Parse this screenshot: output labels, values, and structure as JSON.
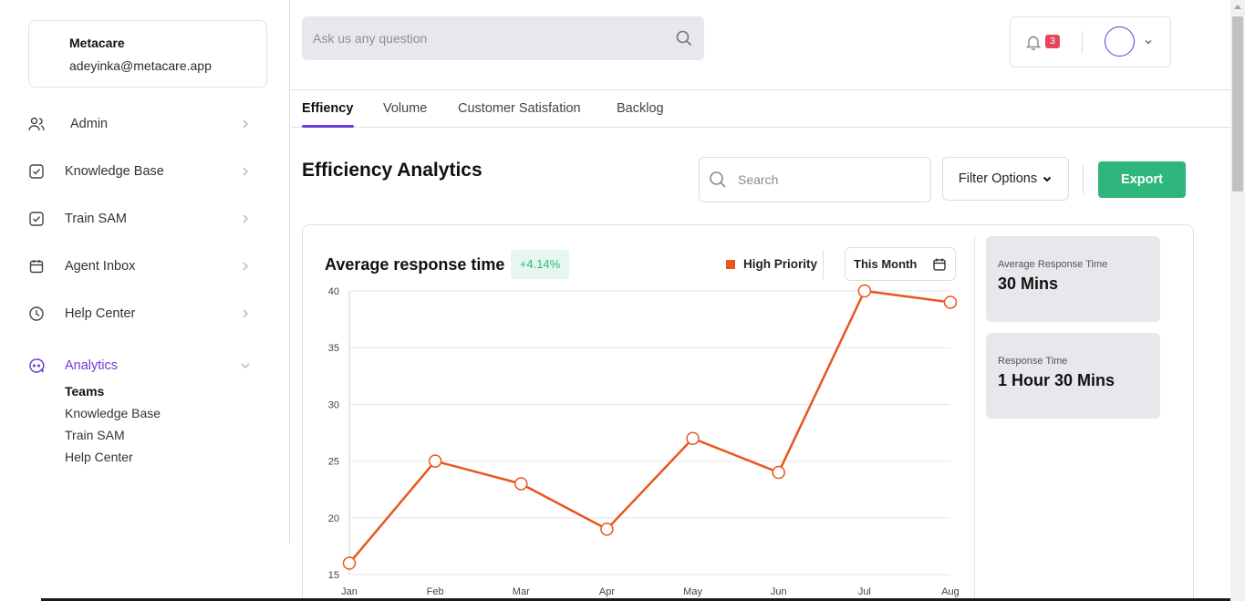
{
  "account": {
    "name": "Metacare",
    "email": "adeyinka@metacare.app"
  },
  "sidebar": {
    "items": [
      {
        "label": "Admin",
        "icon": "users-icon"
      },
      {
        "label": "Knowledge Base",
        "icon": "check-square-icon"
      },
      {
        "label": "Train SAM",
        "icon": "check-square-icon"
      },
      {
        "label": "Agent Inbox",
        "icon": "calendar-icon"
      },
      {
        "label": "Help Center",
        "icon": "clock-icon"
      },
      {
        "label": "Analytics",
        "icon": "chat-bot-icon",
        "active": true
      }
    ],
    "analytics_sub": [
      "Teams",
      "Knowledge Base",
      "Train SAM",
      "Help Center"
    ]
  },
  "topbar": {
    "ask_placeholder": "Ask us any question",
    "notification_count": "3"
  },
  "tabs": [
    "Effiency",
    "Volume",
    "Customer Satisfation",
    "Backlog"
  ],
  "header": {
    "title": "Efficiency Analytics",
    "search_placeholder": "Search",
    "filter_label": "Filter Options",
    "export_label": "Export"
  },
  "chart_panel": {
    "title": "Average response time",
    "change": "+4.14%",
    "legend": "High Priority",
    "period": "This Month"
  },
  "stats": [
    {
      "label": "Average Response Time",
      "value": "30 Mins"
    },
    {
      "label": "Response Time",
      "value": "1 Hour 30 Mins"
    }
  ],
  "colors": {
    "accent": "#6a3fd4",
    "export": "#2eb67d",
    "series": "#e8561f",
    "badge": "#e9455a"
  },
  "chart_data": {
    "type": "line",
    "title": "Average response time",
    "xlabel": "",
    "ylabel": "",
    "categories": [
      "Jan",
      "Feb",
      "Mar",
      "Apr",
      "May",
      "Jun",
      "Jul",
      "Aug"
    ],
    "series": [
      {
        "name": "High Priority",
        "values": [
          16,
          25,
          23,
          19,
          27,
          24,
          40,
          39
        ]
      }
    ],
    "ylim": [
      15,
      40
    ],
    "yticks": [
      15,
      20,
      25,
      30,
      35,
      40
    ],
    "grid": true,
    "legend": "top-right"
  }
}
